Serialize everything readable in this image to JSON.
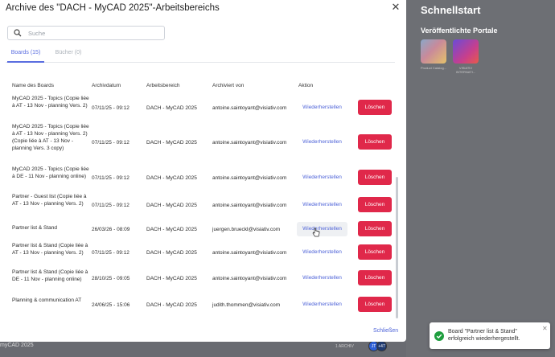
{
  "background": {
    "section_title": "Schnellstart",
    "portals_title": "Veröffentlichte Portale",
    "portals": [
      {
        "label": "Product Catalog..."
      },
      {
        "label": "VISIATIV INTERNATI..."
      }
    ],
    "bottom_left": "myCAD 2025",
    "bottom_archive": "1 ARCHIV",
    "avatars": [
      {
        "initials": "JT"
      },
      {
        "initials": "+47"
      }
    ]
  },
  "modal": {
    "title": "Archive des \"DACH - MyCAD 2025\"-Arbeitsbereichs",
    "search_placeholder": "Suche",
    "tabs": [
      {
        "label": "Boards (15)",
        "active": true
      },
      {
        "label": "Bücher (0)",
        "active": false
      }
    ],
    "columns": [
      "Name des Boards",
      "Archivdatum",
      "Arbeitsbereich",
      "Archiviert von",
      "Aktion"
    ],
    "restore_label": "Wiederherstellen",
    "delete_label": "Löschen",
    "rows": [
      {
        "name": "MyCAD 2025 - Topics (Copie liée à AT - 13 Nov - planning Vers. 2)",
        "date": "07/11/25 - 09:12",
        "area": "DACH - MyCAD 2025",
        "user": "antoine.saintoyant@visiativ.com"
      },
      {
        "name": "MyCAD 2025 - Topics (Copie liée à AT - 13 Nov - planning Vers. 2) (Copie liée à AT - 13 Nov - planning Vers. 3 copy)",
        "date": "07/11/25 - 09:12",
        "area": "DACH - MyCAD 2025",
        "user": "antoine.saintoyant@visiativ.com"
      },
      {
        "name": "MyCAD 2025 - Topics (Copie liée à DE - 11 Nov - planning online)",
        "date": "07/11/25 - 09:12",
        "area": "DACH - MyCAD 2025",
        "user": "antoine.saintoyant@visiativ.com"
      },
      {
        "name": "Partner - Guest list (Copie liée à AT - 13 Nov - planning Vers. 2)",
        "date": "07/11/25 - 09:12",
        "area": "DACH - MyCAD 2025",
        "user": "antoine.saintoyant@visiativ.com"
      },
      {
        "name": "Partner list & Stand",
        "date": "26/03/26 - 08:09",
        "area": "DACH - MyCAD 2025",
        "user": "juergen.brueckl@visiativ.com"
      },
      {
        "name": "Partner list & Stand (Copie liée à AT - 13 Nov - planning Vers. 2)",
        "date": "07/11/25 - 09:12",
        "area": "DACH - MyCAD 2025",
        "user": "antoine.saintoyant@visiativ.com"
      },
      {
        "name": "Partner list & Stand (Copie liée à DE - 11 Nov - planning online)",
        "date": "28/10/25 - 09:05",
        "area": "DACH - MyCAD 2025",
        "user": "antoine.saintoyant@visiativ.com"
      },
      {
        "name": "Planning & communication AT",
        "date": "24/06/25 - 15:06",
        "area": "DACH - MyCAD 2025",
        "user": "judith.thommen@visiativ.com"
      }
    ],
    "close_label": "Schließen"
  },
  "toast": {
    "message": "Board \"Partner list & Stand\" erfolgreich wiederhergestellt."
  },
  "colors": {
    "accent": "#5a6de0",
    "danger": "#e0284a",
    "success": "#1e9e3e"
  }
}
